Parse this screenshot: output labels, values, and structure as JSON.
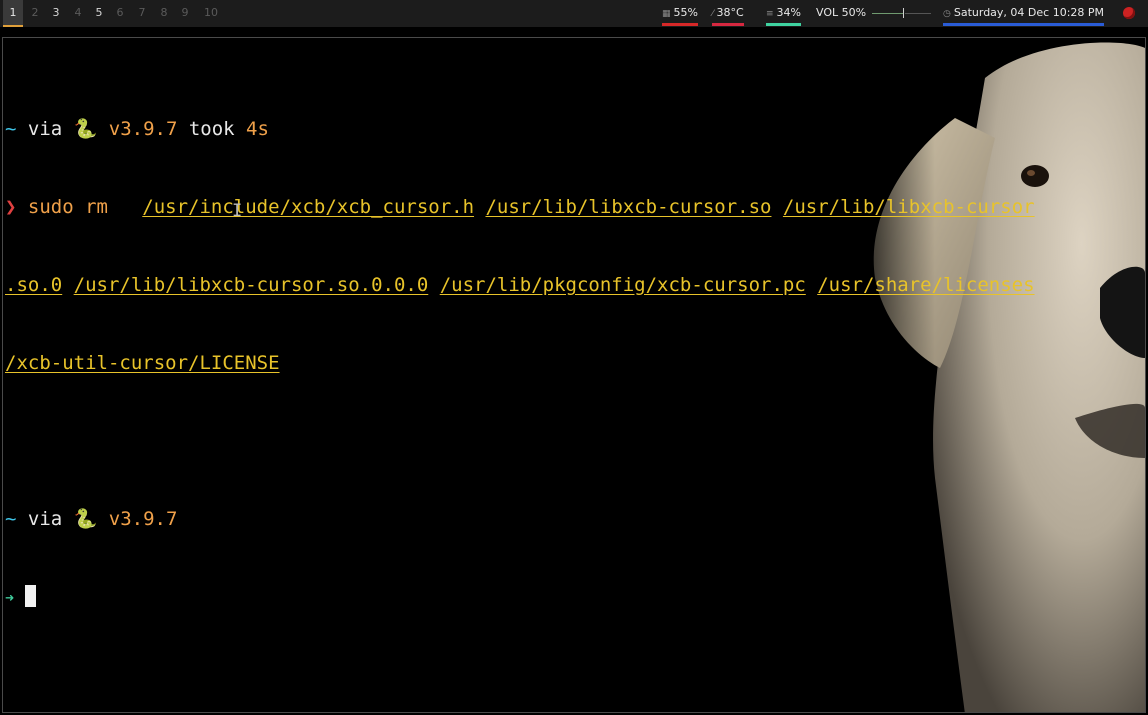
{
  "topbar": {
    "workspaces": [
      {
        "label": "1",
        "state": "active"
      },
      {
        "label": "2",
        "state": "empty"
      },
      {
        "label": "3",
        "state": "occupied"
      },
      {
        "label": "4",
        "state": "empty"
      },
      {
        "label": "5",
        "state": "occupied"
      },
      {
        "label": "6",
        "state": "empty"
      },
      {
        "label": "7",
        "state": "empty"
      },
      {
        "label": "8",
        "state": "empty"
      },
      {
        "label": "9",
        "state": "empty"
      },
      {
        "label": "10",
        "state": "empty"
      }
    ],
    "cpu": {
      "value": "55%",
      "icon": "cpu-icon",
      "color": "#d62828"
    },
    "temp": {
      "value": "38°C",
      "icon": "thermometer-icon",
      "color": "#d62840"
    },
    "memory": {
      "value": "34%",
      "icon": "memory-icon",
      "color": "#3fd3a0"
    },
    "volume": {
      "label": "VOL 50%",
      "level": 0.5
    },
    "datetime": {
      "value": "Saturday, 04 Dec 10:28 PM",
      "icon": "clock-icon",
      "color": "#2a5cd6"
    },
    "power_icon": "power-icon"
  },
  "terminal": {
    "line1": {
      "dir": "~",
      "via": " via ",
      "snake": "🐍",
      "version": " v3.9.7",
      "took": " took ",
      "duration": "4s"
    },
    "line2": {
      "prompt": "❯",
      "cmd": " sudo rm   ",
      "p1": "/usr/include/xcb/xcb_cursor.h",
      "p2": "/usr/lib/libxcb-cursor.so",
      "p3a": "/usr/lib/libxcb-cursor"
    },
    "line3": {
      "p3b": ".so.0",
      "p4": "/usr/lib/libxcb-cursor.so.0.0.0",
      "p5": "/usr/lib/pkgconfig/xcb-cursor.pc",
      "p6a": "/usr/share/licenses"
    },
    "line4": {
      "p6b": "/xcb-util-cursor/LICENSE"
    },
    "line6": {
      "dir": "~",
      "via": " via ",
      "snake": "🐍",
      "version": " v3.9.7"
    },
    "line7": {
      "prompt": "➜"
    },
    "ibeam_icon": "text-cursor-icon",
    "wallpaper_icon": "dog-wallpaper-icon"
  }
}
